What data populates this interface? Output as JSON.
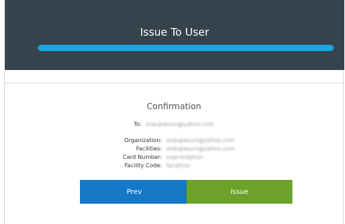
{
  "header": {
    "title": "Issue To User",
    "progress": 1.0
  },
  "confirmation": {
    "title": "Confirmation",
    "to_label": "To:",
    "to_value": "oneupwsun@yahoo.com",
    "rows": [
      {
        "label": "Organization:",
        "value": "oneupwsun@yahoo.com"
      },
      {
        "label": "Facilities:",
        "value": "oneupwsun@yahoo.com"
      },
      {
        "label": "Card Number:",
        "value": "oupcardphon"
      },
      {
        "label": "Facility Code:",
        "value": "faciphon"
      }
    ]
  },
  "buttons": {
    "prev_label": "Prev",
    "issue_label": "Issue"
  },
  "colors": {
    "header_bg": "#36434c",
    "progress": "#17a6de",
    "prev_button": "#1478c7",
    "issue_button": "#6da22a"
  }
}
